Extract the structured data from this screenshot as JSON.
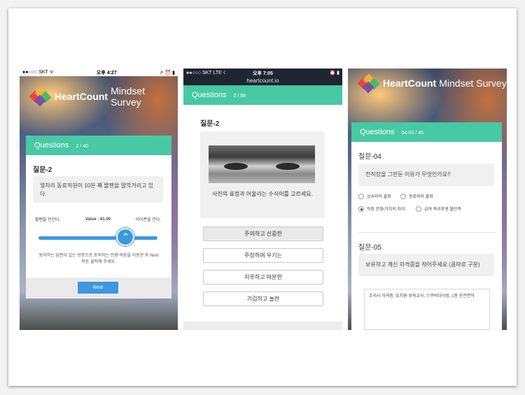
{
  "screen1": {
    "status": {
      "carrier": "●●○○○ SKT ᯤ",
      "time": "오후 4:27",
      "right": "➚ ⏰ ▮"
    },
    "brand": {
      "bold": "HeartCount",
      "light": "Mindset Survey"
    },
    "header": {
      "label": "Questions",
      "counter": "2 / 40"
    },
    "question_title": "질문-2",
    "question_text": "옆자리 동료직원이 10분 째 볼펜을 딸깍거리고 있다.",
    "slider": {
      "left_label": "볼펜을 던진다.",
      "value_label": "Value : 61.00",
      "right_label": "이어폰을 낀다.",
      "value": 61,
      "arrow": "⌃"
    },
    "hint": "동의하는 답변이 있는 방향으로 동의하는 만큼 버튼을 이동한 후 Next버튼 클릭해 주세요.",
    "next_label": "Next"
  },
  "screen2": {
    "status": {
      "carrier": "●●○○○ SKT  LTE ☾",
      "time": "오후 7:05",
      "right": "⏰ ▮",
      "url": "heartcount.io"
    },
    "header": {
      "label": "Questions",
      "counter": "2 / 88"
    },
    "question_title": "질문-2",
    "question_text": "사진의 표정과 어울리는 수식어를 고르세요.",
    "options": [
      "주의하고 신중한",
      "주장하며 우기는",
      "지루하고 따분한",
      "기겁하고 놀란"
    ]
  },
  "screen3": {
    "brand": {
      "bold": "HeartCount",
      "light": "Mindset Survey"
    },
    "header": {
      "label": "Questions",
      "counter": "04-05 / 45"
    },
    "q4": {
      "title": "질문-04",
      "text": "전직장을 그만둔 이유가 무엇인가요?",
      "options": [
        "상사와의 불화",
        "동료와의 불화",
        "직장 문화/가치의 차이",
        "급여 복리후생 불만족"
      ],
      "selected_index": 2
    },
    "q5": {
      "title": "질문-05",
      "text": "보유하고 계신 자격증을 적어주세요 (콤마로 구분)",
      "answer": "조리사 자격증, 유치원 보육교사, 스쿠버다이빙, 1종 운전면허"
    }
  }
}
